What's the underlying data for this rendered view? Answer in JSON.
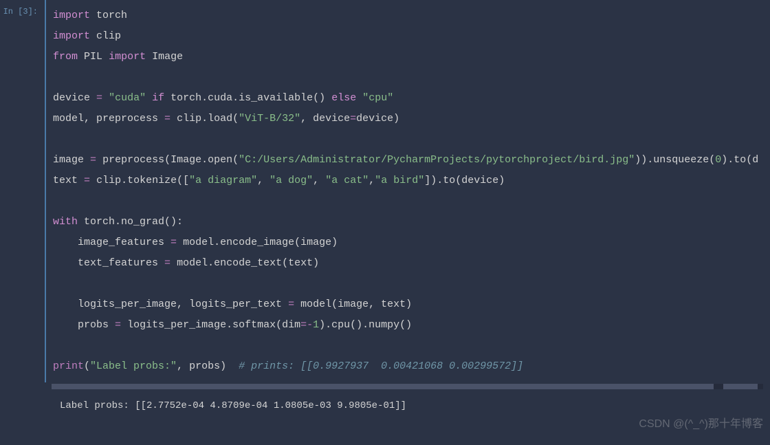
{
  "cell": {
    "prompt": "In [3]:",
    "code": {
      "l1_import": "import",
      "l1_torch": "torch",
      "l2_import": "import",
      "l2_clip": "clip",
      "l3_from": "from",
      "l3_pil": "PIL",
      "l3_import": "import",
      "l3_image": "Image",
      "l5_device": "device",
      "l5_eq": "=",
      "l5_cuda": "\"cuda\"",
      "l5_if": "if",
      "l5_cond": "torch.cuda.is_available()",
      "l5_else": "else",
      "l5_cpu": "\"cpu\"",
      "l6_lhs": "model, preprocess",
      "l6_eq": "=",
      "l6_clip_load": "clip.load(",
      "l6_vit": "\"ViT-B/32\"",
      "l6_comma": ", device",
      "l6_eq2": "=",
      "l6_device2": "device)",
      "l8_image": "image",
      "l8_eq": "=",
      "l8_pre": "preprocess(Image.open(",
      "l8_path": "\"C:/Users/Administrator/PycharmProjects/pytorchproject/bird.jpg\"",
      "l8_post": ")).unsqueeze(",
      "l8_zero": "0",
      "l8_tail": ").to(d",
      "l9_text": "text",
      "l9_eq": "=",
      "l9_clip": "clip.tokenize([",
      "l9_s1": "\"a diagram\"",
      "l9_c1": ",",
      "l9_s2": "\"a dog\"",
      "l9_c2": ",",
      "l9_s3": "\"a cat\"",
      "l9_c3": ",",
      "l9_s4": "\"a bird\"",
      "l9_tail": "]).to(device)",
      "l11_with": "with",
      "l11_ng": "torch.no_grad():",
      "l12_lhs": "    image_features",
      "l12_eq": "=",
      "l12_rhs": "model.encode_image(image)",
      "l13_lhs": "    text_features",
      "l13_eq": "=",
      "l13_rhs": "model.encode_text(text)",
      "l15_lhs": "    logits_per_image, logits_per_text",
      "l15_eq": "=",
      "l15_rhs": "model(image, text)",
      "l16_lhs": "    probs",
      "l16_eq": "=",
      "l16_rhs_a": "logits_per_image.softmax(dim",
      "l16_eq2": "=-",
      "l16_one": "1",
      "l16_rhs_b": ").cpu().numpy()",
      "l18_print": "print",
      "l18_open": "(",
      "l18_str": "\"Label probs:\"",
      "l18_args": ", probs)  ",
      "l18_comment": "# prints: [[0.9927937  0.00421068 0.00299572]]"
    },
    "output": "Label probs: [[2.7752e-04 4.8709e-04 1.0805e-03 9.9805e-01]]"
  },
  "watermark": "CSDN @(^_^)那十年博客"
}
